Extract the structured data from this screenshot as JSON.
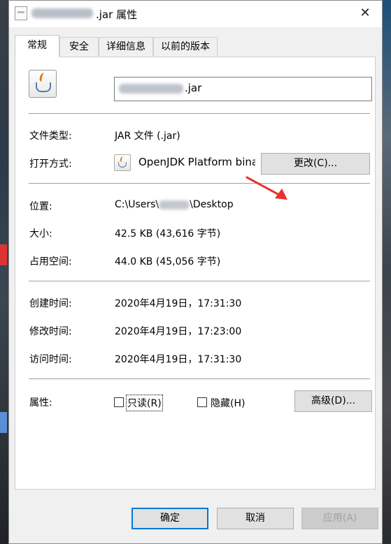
{
  "window": {
    "title": ".jar 属性",
    "close_glyph": "✕"
  },
  "tabs": [
    {
      "label": "常规",
      "active": true
    },
    {
      "label": "安全",
      "active": false
    },
    {
      "label": "详细信息",
      "active": false
    },
    {
      "label": "以前的版本",
      "active": false
    }
  ],
  "general": {
    "file_name_visible": ".jar",
    "file_type_label": "文件类型:",
    "file_type_value": "JAR 文件 (.jar)",
    "opens_with_label": "打开方式:",
    "opens_with_value": "OpenJDK Platform bina",
    "change_button": "更改(C)...",
    "location_label": "位置:",
    "location_prefix": "C:\\Users\\",
    "location_suffix": "\\Desktop",
    "size_label": "大小:",
    "size_value": "42.5 KB (43,616 字节)",
    "size_on_disk_label": "占用空间:",
    "size_on_disk_value": "44.0 KB (45,056 字节)",
    "created_label": "创建时间:",
    "created_value": "2020年4月19日，17:31:30",
    "modified_label": "修改时间:",
    "modified_value": "2020年4月19日，17:23:00",
    "accessed_label": "访问时间:",
    "accessed_value": "2020年4月19日，17:31:30",
    "attributes_label": "属性:",
    "readonly_label": "只读(R)",
    "readonly_checked": false,
    "hidden_label": "隐藏(H)",
    "hidden_checked": false,
    "advanced_button": "高级(D)..."
  },
  "footer": {
    "ok_button": "确定",
    "cancel_button": "取消",
    "apply_button": "应用(A)"
  },
  "colors": {
    "annotation_arrow": "#e8322d",
    "focus_border": "#0078d7"
  }
}
